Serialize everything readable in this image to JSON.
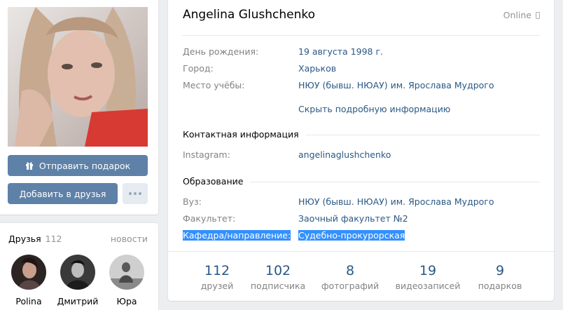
{
  "profile": {
    "name": "Angelina Glushchenko",
    "status": "Online"
  },
  "left": {
    "gift_label": "Отправить подарок",
    "add_friend_label": "Добавить в друзья"
  },
  "info": {
    "birthday": {
      "label": "День рождения:",
      "value": "19 августа 1998 г."
    },
    "city": {
      "label": "Город:",
      "value": "Харьков"
    },
    "study": {
      "label": "Место учёбы:",
      "value": "НЮУ (бывш. НЮАУ) им. Ярослава Мудрого"
    },
    "hide_link": "Скрыть подробную информацию"
  },
  "contacts": {
    "title": "Контактная информация",
    "instagram": {
      "label": "Instagram:",
      "value": "angelinaglushchenko"
    }
  },
  "education": {
    "title": "Образование",
    "university": {
      "label": "Вуз:",
      "value": "НЮУ (бывш. НЮАУ) им. Ярослава Мудрого"
    },
    "faculty": {
      "label": "Факультет:",
      "value": "Заочный факультет №2"
    },
    "chair": {
      "label": "Кафедра/направление:",
      "value": "Судебно-прокурорская"
    }
  },
  "counters": [
    {
      "num": "112",
      "label": "друзей"
    },
    {
      "num": "102",
      "label": "подписчика"
    },
    {
      "num": "8",
      "label": "фотографий"
    },
    {
      "num": "19",
      "label": "видеозаписей"
    },
    {
      "num": "9",
      "label": "подарков"
    }
  ],
  "friends": {
    "title": "Друзья",
    "count": "112",
    "news_label": "новости",
    "items": [
      {
        "name": "Polina"
      },
      {
        "name": "Дмитрий"
      },
      {
        "name": "Юра"
      }
    ]
  },
  "colors": {
    "accent": "#5e81a8",
    "link": "#2a5885",
    "selection": "#3390ff"
  }
}
